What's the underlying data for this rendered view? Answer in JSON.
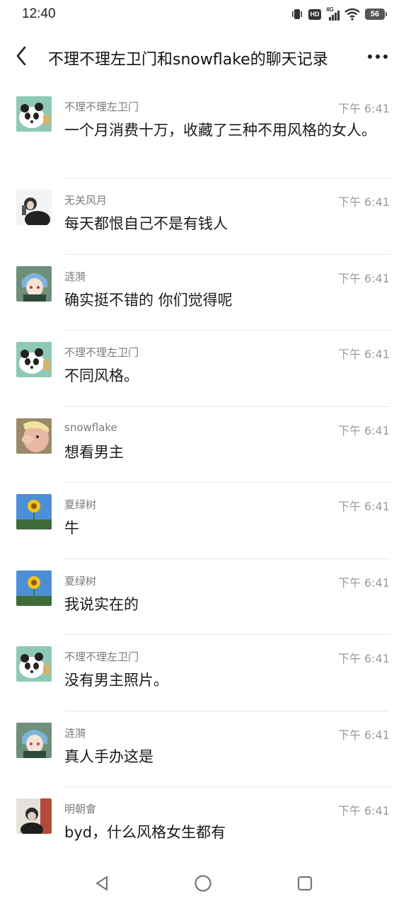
{
  "status": {
    "time": "12:40",
    "hd": "HD",
    "network": "4G",
    "battery": "56",
    "icons": [
      "vibrate-icon",
      "hd-icon",
      "signal-4g-icon",
      "wifi-icon",
      "battery-icon"
    ]
  },
  "header": {
    "title": "不理不理左卫门和snowflake的聊天记录",
    "back_icon": "back-chevron-icon",
    "more_icon": "more-dots-icon"
  },
  "messages": [
    {
      "sender": "不理不理左卫门",
      "time": "下午 6:41",
      "text": "一个月消费十万，收藏了三种不用风格的女人。",
      "avatar": "panda-avatar"
    },
    {
      "sender": "无关风月",
      "time": "下午 6:41",
      "text": "每天都恨自己不是有钱人",
      "avatar": "person-avatar"
    },
    {
      "sender": "涟漪",
      "time": "下午 6:41",
      "text": "确实挺不错的 你们觉得呢",
      "avatar": "anime-avatar"
    },
    {
      "sender": "不理不理左卫门",
      "time": "下午 6:41",
      "text": "不同风格。",
      "avatar": "panda-avatar"
    },
    {
      "sender": "snowflake",
      "time": "下午 6:41",
      "text": "想看男主",
      "avatar": "cartoon-avatar"
    },
    {
      "sender": "夏绿树",
      "time": "下午 6:41",
      "text": "牛",
      "avatar": "sunflower-avatar"
    },
    {
      "sender": "夏绿树",
      "time": "下午 6:41",
      "text": "我说实在的",
      "avatar": "sunflower-avatar"
    },
    {
      "sender": "不理不理左卫门",
      "time": "下午 6:41",
      "text": "没有男主照片。",
      "avatar": "panda-avatar"
    },
    {
      "sender": "涟漪",
      "time": "下午 6:41",
      "text": "真人手办这是",
      "avatar": "anime-avatar"
    },
    {
      "sender": "明朝會",
      "time": "下午 6:41",
      "text": "byd，什么风格女生都有",
      "avatar": "person2-avatar"
    }
  ],
  "navbar": {
    "icons": [
      "nav-back-icon",
      "nav-home-icon",
      "nav-recents-icon"
    ]
  },
  "colors": {
    "background": "#ffffff",
    "name": "#7a7a7a",
    "time": "#9a9a9a",
    "text": "#1a1a1a",
    "divider": "#e7e7e7"
  }
}
